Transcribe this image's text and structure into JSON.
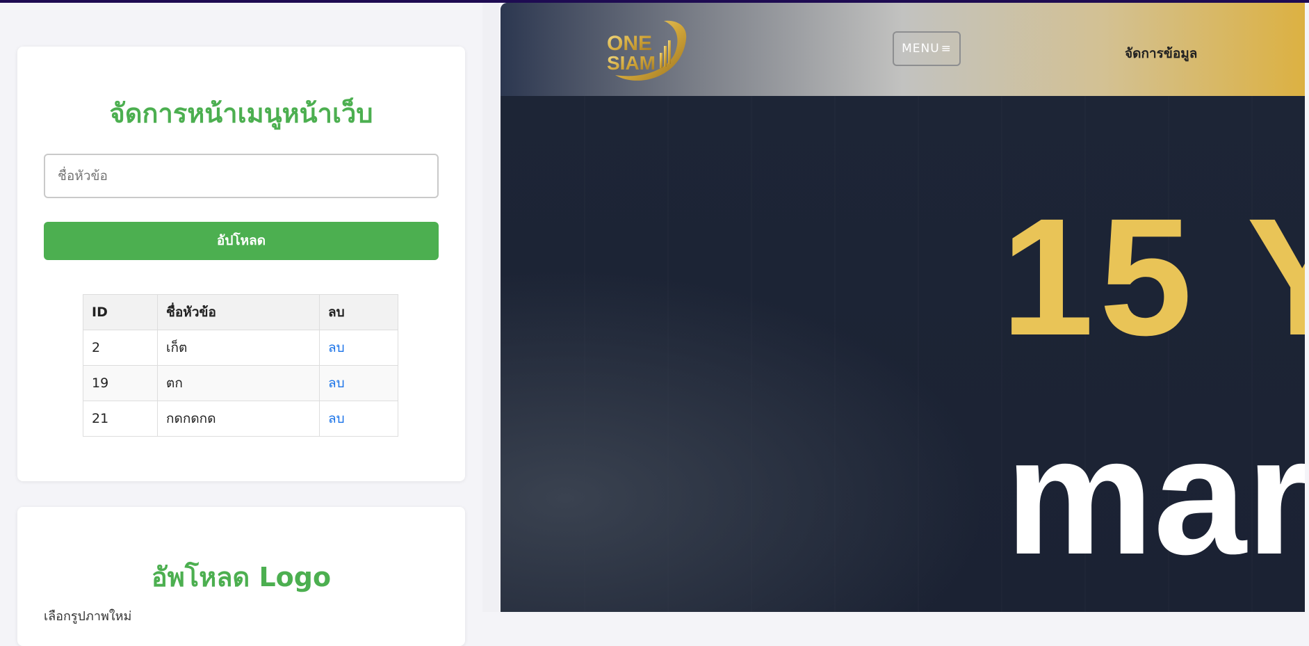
{
  "menu_manager": {
    "title": "จัดการหน้าเมนูหน้าเว็บ",
    "topic_placeholder": "ชื่อหัวข้อ",
    "upload_label": "อัปโหลด",
    "table": {
      "headers": [
        "ID",
        "ชื่อหัวข้อ",
        "ลบ"
      ],
      "rows": [
        {
          "id": "2",
          "name": "เก็ต",
          "action": "ลบ"
        },
        {
          "id": "19",
          "name": "ตก",
          "action": "ลบ"
        },
        {
          "id": "21",
          "name": "กดกดกด",
          "action": "ลบ"
        }
      ]
    }
  },
  "logo_upload": {
    "title": "อัพโหลด Logo",
    "choose_label": "เลือกรูปภาพใหม่"
  },
  "preview": {
    "logo_line1": "ONE",
    "logo_line2": "SIAM",
    "menu_label": "MENU",
    "manage_label": "จัดการข้อมูล",
    "hero_line1": "15 Y",
    "hero_line2": "mar"
  },
  "colors": {
    "accent_green": "#4caf50",
    "link_blue": "#1a73e8",
    "hero_gold": "#e9c457",
    "top_bar": "#1e0b52"
  }
}
